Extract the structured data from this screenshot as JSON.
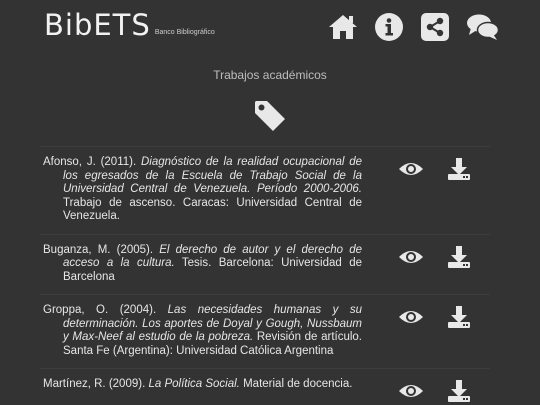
{
  "header": {
    "logo_word": "BibETS",
    "logo_sub": "Banco Bibliográfico",
    "nav": [
      {
        "name": "home-icon"
      },
      {
        "name": "info-icon"
      },
      {
        "name": "share-icon"
      },
      {
        "name": "chat-icon"
      }
    ]
  },
  "section": {
    "title": "Trabajos académicos",
    "icon": "tag-icon"
  },
  "items": [
    {
      "author": "Afonso, J. (2011).",
      "title": "Diagnóstico de la realidad ocupacional de los egresados de la Escuela de Trabajo Social de la Universidad Central de Venezuela. Período 2000-2006.",
      "rest": "Trabajo de ascenso. Caracas: Universidad Central de Venezuela."
    },
    {
      "author": "Buganza, M. (2005).",
      "title": "El derecho de autor y el derecho de acceso a la cultura.",
      "rest": "Tesis. Barcelona: Universidad de Barcelona"
    },
    {
      "author": "Groppa, O. (2004).",
      "title": "Las necesidades humanas y su determinación. Los aportes de Doyal y Gough, Nussbaum y Max-Neef al estudio de la pobreza.",
      "rest": "Revisión de artículo. Santa Fe (Argentina): Universidad Católica Argentina"
    },
    {
      "author": "Martínez, R. (2009).",
      "title": "La Política Social.",
      "rest": "Material de docencia."
    }
  ],
  "colors": {
    "background": "#333333",
    "text": "#e6e6e6",
    "icon": "#e8e8e8"
  }
}
